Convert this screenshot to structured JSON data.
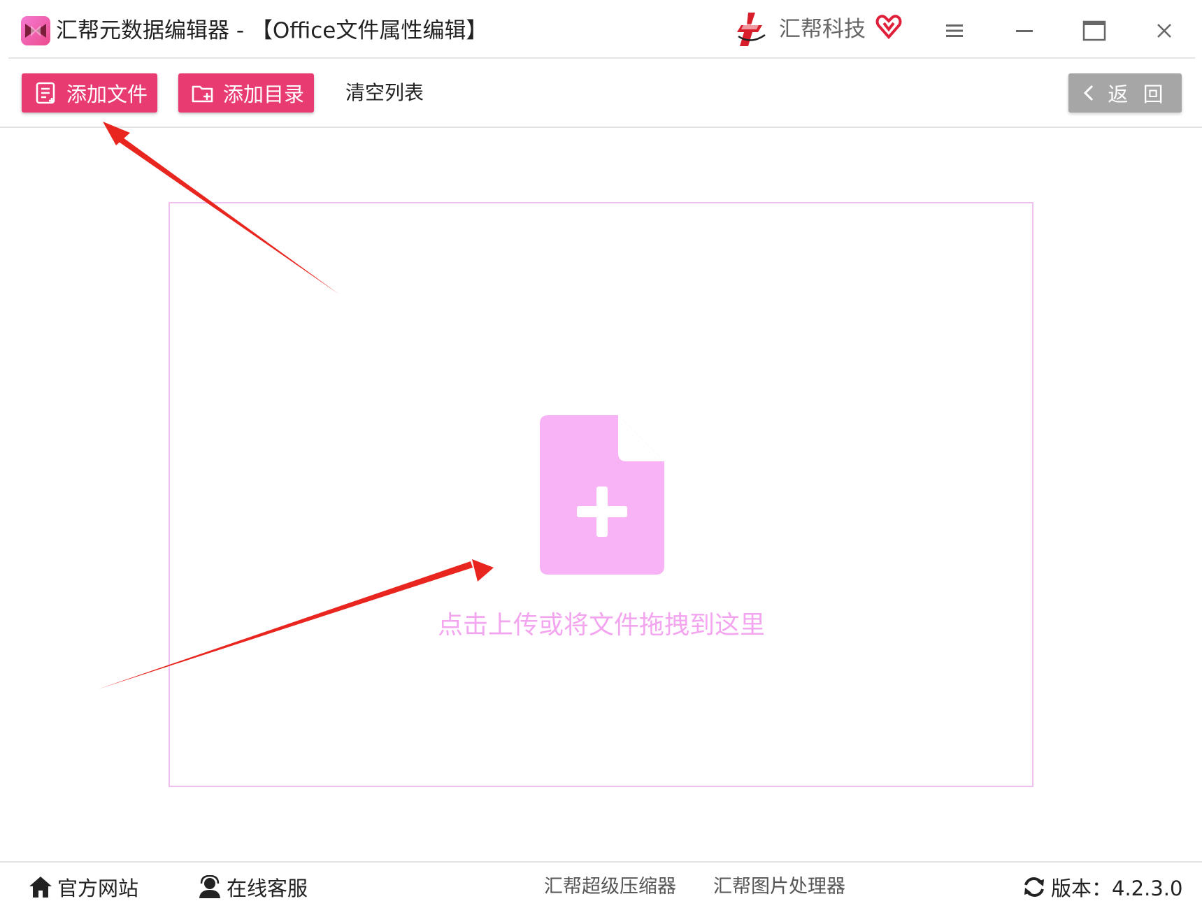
{
  "window": {
    "title": "汇帮元数据编辑器 - 【Office文件属性编辑】",
    "brand_name": "汇帮科技",
    "controls": [
      "menu-icon",
      "minimize-icon",
      "maximize-icon",
      "close-icon"
    ]
  },
  "toolbar": {
    "add_file_label": "添加文件",
    "add_folder_label": "添加目录",
    "clear_list_label": "清空列表",
    "back_label": "返 回"
  },
  "dropzone": {
    "hint": "点击上传或将文件拖拽到这里"
  },
  "statusbar": {
    "website_label": "官方网站",
    "support_label": "在线客服",
    "compressor_link": "汇帮超级压缩器",
    "image_tool_link": "汇帮图片处理器",
    "version_label": "版本：4.2.3.0"
  },
  "colors": {
    "accent": "#e83b72",
    "back_button": "#a6a6a6",
    "dropzone_border": "#efc0ef",
    "dropzone_icon": "#f7b3f6",
    "hint_text": "#f3a6ef",
    "annotation_arrow": "#e8261f"
  }
}
